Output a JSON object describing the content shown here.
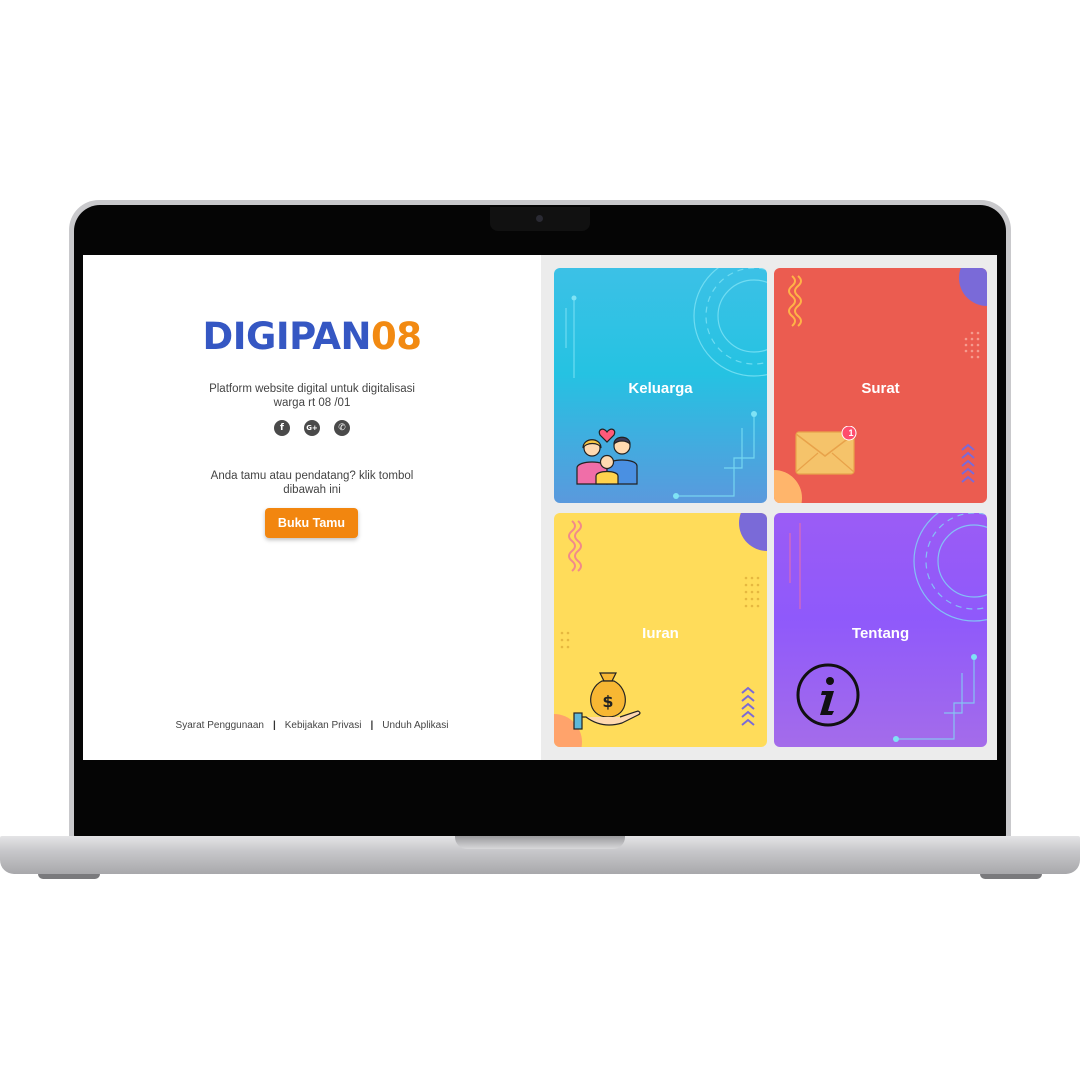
{
  "app": {
    "logo_part1": "DIGIPAN",
    "logo_part2": "08",
    "tagline_line1": "Platform website digital untuk digitalisasi",
    "tagline_line2": "warga rt 08 /01"
  },
  "socials": [
    {
      "name": "facebook",
      "glyph": "f"
    },
    {
      "name": "google-plus",
      "glyph": "G+"
    },
    {
      "name": "whatsapp",
      "glyph": "✆"
    }
  ],
  "guest": {
    "prompt_line1": "Anda tamu atau pendatang? klik tombol",
    "prompt_line2": "dibawah ini",
    "button_label": "Buku Tamu"
  },
  "footer": {
    "links": [
      "Syarat Penggunaan",
      "Kebijakan Privasi",
      "Unduh Aplikasi"
    ],
    "separator": "|"
  },
  "tiles": [
    {
      "label": "Keluarga",
      "icon": "family-icon",
      "color": "#3cc1e6"
    },
    {
      "label": "Surat",
      "icon": "envelope-icon",
      "badge": "1",
      "color": "#eb5c50"
    },
    {
      "label": "Iuran",
      "icon": "money-bag-icon",
      "color": "#ffdc5a"
    },
    {
      "label": "Tentang",
      "icon": "info-icon",
      "color": "#9b5cf5"
    }
  ],
  "colors": {
    "brand_blue": "#3557c3",
    "brand_orange": "#f28a12",
    "button_orange": "#f2860f"
  }
}
